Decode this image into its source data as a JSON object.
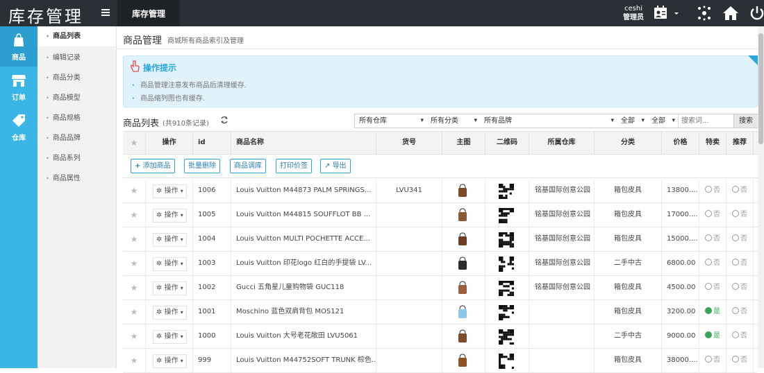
{
  "app": {
    "title": "库存管理"
  },
  "header": {
    "tab": "库存管理",
    "user_name": "ceshi",
    "user_role": "管理员"
  },
  "sidebar": {
    "items": [
      {
        "label": "商品",
        "icon": "shopping-bag-icon"
      },
      {
        "label": "订单",
        "icon": "shop-icon"
      },
      {
        "label": "仓库",
        "icon": "tag-icon"
      }
    ]
  },
  "subnav": {
    "items": [
      "商品列表",
      "编辑记录",
      "商品分类",
      "商品模型",
      "商品规格",
      "商品品牌",
      "商品系列",
      "商品属性"
    ]
  },
  "page": {
    "title": "商品管理",
    "subtitle": "商城所有商品索引及管理"
  },
  "tips": {
    "title": "操作提示",
    "lines": [
      "商品管理注意发布商品后清理缓存.",
      "商品缩列图也有缓存."
    ]
  },
  "list": {
    "title": "商品列表",
    "count": "(共910条记录)"
  },
  "filters": {
    "warehouse": "所有仓库",
    "category": "所有分类",
    "brand": "所有品牌",
    "all1": "全部",
    "all2": "全部",
    "search_placeholder": "搜索词...",
    "search_label": "搜索"
  },
  "table": {
    "headers": [
      "操作",
      "id",
      "商品名称",
      "货号",
      "主图",
      "二维码",
      "所属仓库",
      "分类",
      "价格",
      "特卖",
      "推荐"
    ],
    "toolbar": [
      "添加商品",
      "批量删除",
      "商品调库",
      "打印价签",
      "导出"
    ],
    "op_label": "操作",
    "rows": [
      {
        "id": "1006",
        "name": "Louis Vuitton M44873 PALM SPRINGS...",
        "sku": "LVU341",
        "warehouse": "铭基国际创意公园",
        "category": "箱包皮具",
        "price": "13800....",
        "special": "否",
        "recommend": "否"
      },
      {
        "id": "1005",
        "name": "Louis Vuitton M44815 SOUFFLOT BB ...",
        "sku": "",
        "warehouse": "铭基国际创意公园",
        "category": "箱包皮具",
        "price": "17000....",
        "special": "否",
        "recommend": "否"
      },
      {
        "id": "1004",
        "name": "Louis Vuitton MULTI POCHETTE ACCE...",
        "sku": "",
        "warehouse": "铭基国际创意公园",
        "category": "箱包皮具",
        "price": "15000....",
        "special": "否",
        "recommend": "否"
      },
      {
        "id": "1003",
        "name": "Louis Vuitton 印花logo 红白的手提袋 LV...",
        "sku": "",
        "warehouse": "铭基国际创意公园",
        "category": "二手中古",
        "price": "6800.00",
        "special": "否",
        "recommend": "否"
      },
      {
        "id": "1002",
        "name": "Gucci 五角星儿童购物袋 GUC118",
        "sku": "",
        "warehouse": "铭基国际创意公园",
        "category": "箱包皮具",
        "price": "4500.00",
        "special": "否",
        "recommend": "否"
      },
      {
        "id": "1001",
        "name": "Moschino 蓝色双肩背包 MOS121",
        "sku": "",
        "warehouse": "",
        "category": "箱包皮具",
        "price": "3200.00",
        "special": "是",
        "recommend": "否"
      },
      {
        "id": "1000",
        "name": "Louis Vuitton 大号老花敞田 LVU5061",
        "sku": "",
        "warehouse": "",
        "category": "二手中古",
        "price": "9000.00",
        "special": "是",
        "recommend": "否"
      },
      {
        "id": "999",
        "name": "Louis Vuitton M44752SOFT TRUNK 棕色...",
        "sku": "",
        "warehouse": "",
        "category": "箱包皮具",
        "price": "38000....",
        "special": "否",
        "recommend": "否"
      }
    ]
  }
}
